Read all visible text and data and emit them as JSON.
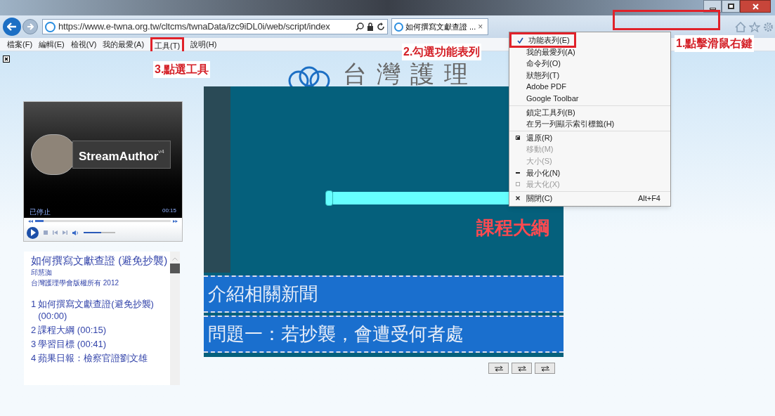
{
  "browser": {
    "url": "https://www.e-twna.org.tw/cltcms/twnaData/izc9iDL0i/web/script/index",
    "tab_title": "如何撰寫文獻查證 ...",
    "tab_close": "×",
    "menu": [
      "檔案(F)",
      "編輯(E)",
      "檢視(V)",
      "我的最愛(A)",
      "工具(T)",
      "說明(H)"
    ]
  },
  "site_header": "台灣護理",
  "player": {
    "logo": "StreamAuthor",
    "version": "v4",
    "status": "已停止",
    "time": "00:15",
    "progress": {
      "level": 0.06
    },
    "volume": {
      "level": 0.55
    }
  },
  "outline": {
    "title": "如何撰寫文獻查證 (避免抄襲)",
    "author": "邱慧洳",
    "copyright": "台灣護理學會版權所有 2012",
    "chapters": [
      {
        "number": "1",
        "title": "如何撰寫文獻查證(避免抄襲) (00:00)"
      },
      {
        "number": "2",
        "title": "課程大綱 (00:15)"
      },
      {
        "number": "3",
        "title": "學習目標 (00:41)"
      },
      {
        "number": "4",
        "title": "蘋果日報：檢察官證劉文雄"
      }
    ]
  },
  "slide": {
    "heading": "課程大綱",
    "bands": [
      "介紹相關新聞",
      "問題一：若抄襲，會遭受何者處"
    ]
  },
  "context_menu": {
    "groups": [
      [
        {
          "kind": "check",
          "label": "功能表列(E)",
          "checked": true,
          "disabled": false
        },
        {
          "kind": "check",
          "label": "我的最愛列(A)",
          "checked": false,
          "disabled": false
        },
        {
          "kind": "check",
          "label": "命令列(O)",
          "checked": false,
          "disabled": false
        },
        {
          "kind": "check",
          "label": "狀態列(T)",
          "checked": false,
          "disabled": false
        },
        {
          "kind": "check",
          "label": "Adobe PDF",
          "checked": false,
          "disabled": false
        },
        {
          "kind": "check",
          "label": "Google Toolbar",
          "checked": false,
          "disabled": false
        }
      ],
      [
        {
          "kind": "check",
          "label": "鎖定工具列(B)",
          "checked": false,
          "disabled": false
        },
        {
          "kind": "check",
          "label": "在另一列顯示索引標籤(H)",
          "checked": false,
          "disabled": false
        }
      ],
      [
        {
          "kind": "restore",
          "label": "還原(R)",
          "disabled": false
        },
        {
          "kind": "plain",
          "label": "移動(M)",
          "disabled": true
        },
        {
          "kind": "plain",
          "label": "大小(S)",
          "disabled": true
        },
        {
          "kind": "minimize",
          "label": "最小化(N)",
          "disabled": false
        },
        {
          "kind": "maximize",
          "label": "最大化(X)",
          "disabled": true
        }
      ],
      [
        {
          "kind": "close",
          "label": "關閉(C)",
          "shortcut": "Alt+F4",
          "disabled": false
        }
      ]
    ]
  },
  "annotations": [
    "1.點擊滑鼠右鍵",
    "2.勾選功能表列",
    "3.點選工具"
  ]
}
